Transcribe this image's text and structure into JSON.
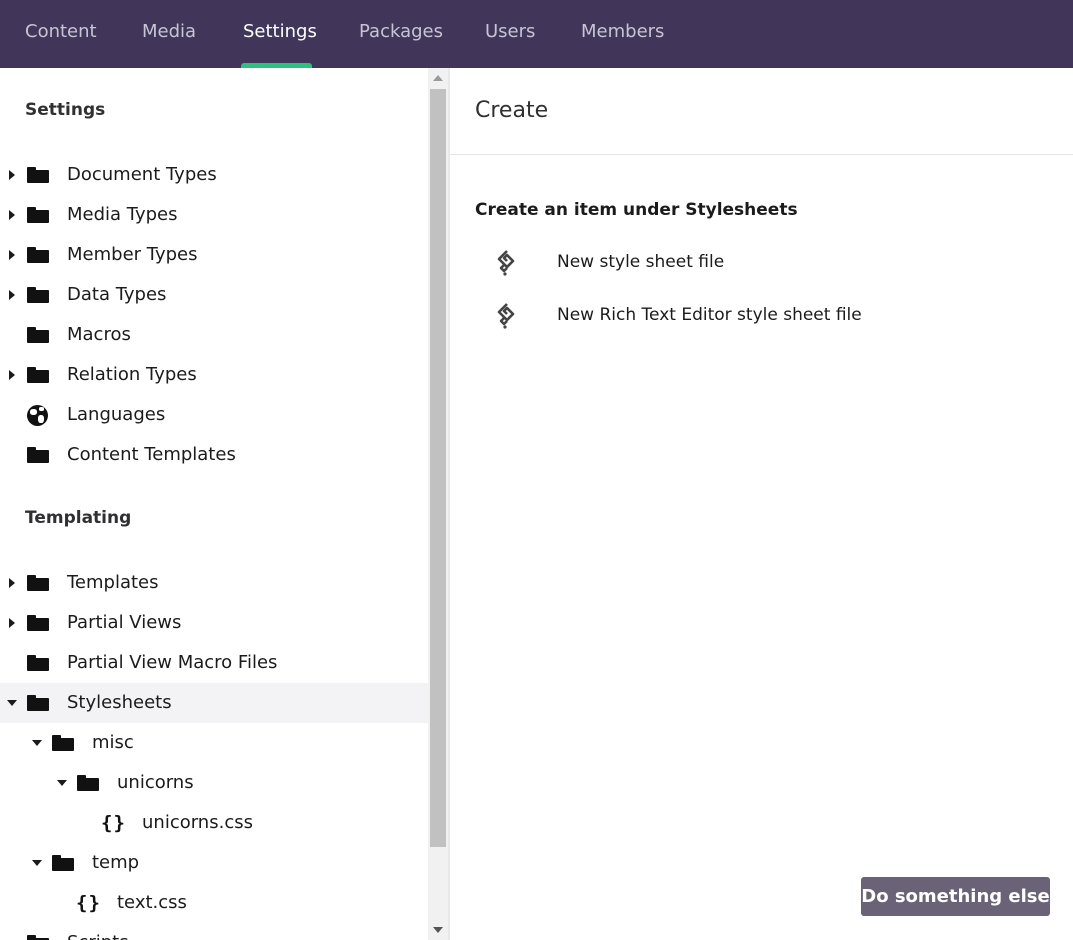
{
  "nav": {
    "tabs": [
      {
        "label": "Content"
      },
      {
        "label": "Media"
      },
      {
        "label": "Settings"
      },
      {
        "label": "Packages"
      },
      {
        "label": "Users"
      },
      {
        "label": "Members"
      }
    ],
    "active_tab": "Settings"
  },
  "sidebar": {
    "settings_title": "Settings",
    "settings_items": [
      {
        "label": "Document Types",
        "icon": "folder-icon",
        "expandable": true
      },
      {
        "label": "Media Types",
        "icon": "folder-icon",
        "expandable": true
      },
      {
        "label": "Member Types",
        "icon": "folder-icon",
        "expandable": true
      },
      {
        "label": "Data Types",
        "icon": "folder-icon",
        "expandable": true
      },
      {
        "label": "Macros",
        "icon": "folder-icon",
        "expandable": false
      },
      {
        "label": "Relation Types",
        "icon": "folder-icon",
        "expandable": true
      },
      {
        "label": "Languages",
        "icon": "globe-icon",
        "expandable": false
      },
      {
        "label": "Content Templates",
        "icon": "folder-icon",
        "expandable": false
      }
    ],
    "templating_title": "Templating",
    "templating_items": [
      {
        "label": "Templates",
        "icon": "folder-icon",
        "expandable": true
      },
      {
        "label": "Partial Views",
        "icon": "folder-icon",
        "expandable": true
      },
      {
        "label": "Partial View Macro Files",
        "icon": "folder-icon",
        "expandable": false
      },
      {
        "label": "Stylesheets",
        "icon": "folder-icon",
        "expanded": true,
        "selected": true
      },
      {
        "label": "misc",
        "icon": "folder-icon",
        "expanded": true
      },
      {
        "label": "unicorns",
        "icon": "folder-icon",
        "expanded": true
      },
      {
        "label": "unicorns.css",
        "icon": "braces-icon"
      },
      {
        "label": "temp",
        "icon": "folder-icon",
        "expanded": true
      },
      {
        "label": "text.css",
        "icon": "braces-icon"
      },
      {
        "label": "Scripts",
        "icon": "folder-icon"
      }
    ]
  },
  "main": {
    "title": "Create",
    "heading": "Create an item under Stylesheets",
    "options": [
      {
        "label": "New style sheet file",
        "icon": "stylesheet-icon"
      },
      {
        "label": "New Rich Text Editor style sheet file",
        "icon": "stylesheet-icon"
      }
    ],
    "action_button": "Do something else"
  },
  "colors": {
    "topbar": "#413659",
    "active_underline": "#2bc37c",
    "button": "#6a6377",
    "selected_row": "#f3f3f5"
  }
}
